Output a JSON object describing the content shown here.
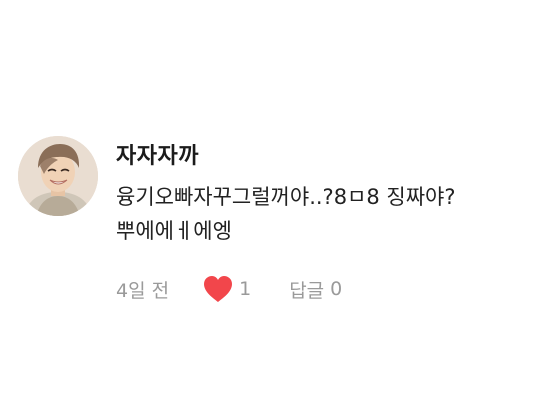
{
  "comment": {
    "author": "자자자까",
    "text": "융기오빠자꾸그럴꺼야..?8ㅁ8 징짜야?\n뿌에에ㅔ에엥",
    "time": "4일 전",
    "likes": "1",
    "reply_label": "답글",
    "reply_count": "0",
    "heart_color": "#f2464b",
    "avatar_icon": "avatar-photo"
  }
}
